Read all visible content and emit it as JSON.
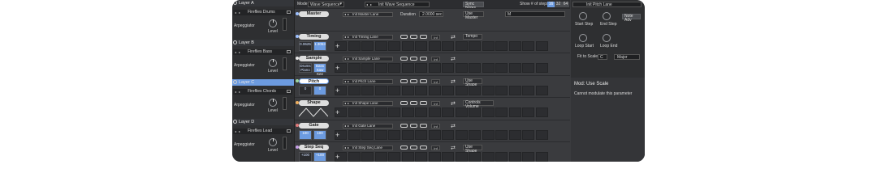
{
  "left": {
    "layers": [
      {
        "name": "Layer A",
        "preset": "Fireflies Drums",
        "arp": "Arpeggiator",
        "level": "Level",
        "selected": false
      },
      {
        "name": "Layer B",
        "preset": "Fireflies Bass",
        "arp": "Arpeggiator",
        "level": "Level",
        "selected": false
      },
      {
        "name": "Layer C",
        "preset": "Fireflies Chords",
        "arp": "Arpeggiator",
        "level": "Level",
        "selected": true
      },
      {
        "name": "Layer D",
        "preset": "Fireflies Lead",
        "arp": "Arpeggiator",
        "level": "Level",
        "selected": false
      }
    ]
  },
  "topbar": {
    "mode_label": "Mode",
    "mode_value": "Wave Sequence",
    "wave_seq_name": "Init Wave Sequence",
    "sync_notes": "Sync Notes",
    "steps_label": "Show # of steps",
    "steps": [
      "16",
      "32",
      "64"
    ]
  },
  "lanes": [
    {
      "name": "Master",
      "preset": "Init Master Lane",
      "duration_label": "Duration",
      "duration": "2.0000 sec",
      "use": "Use Master",
      "master_input": "M",
      "dot": "#9ec1ff"
    },
    {
      "name": "Timing",
      "preset": "Init Timing Lane",
      "use": "Tempo",
      "values": [
        "0.0625",
        "1.3053"
      ],
      "inf": "Inf",
      "dot": "#9ec1ff"
    },
    {
      "name": "Sample",
      "preset": "Init Sample Lane",
      "values": [
        "Drums Piano",
        "Bass Saw Key"
      ],
      "inf": "Inf",
      "dot": "#e8e8e8"
    },
    {
      "name": "Pitch",
      "preset": "Init Pitch Lane",
      "use": "Use Shape",
      "values": [
        "0",
        "0"
      ],
      "inf": "Inf",
      "dot": "#9ed7a0"
    },
    {
      "name": "Shape",
      "preset": "Init Shape Lane",
      "use": "Controls Volume",
      "inf": "Inf",
      "dot": "#f0b060"
    },
    {
      "name": "Gate",
      "preset": "Init Gate Lane",
      "values": [
        "100",
        "100"
      ],
      "inf": "Inf",
      "dot": "#e07a7a"
    },
    {
      "name": "Step Seq",
      "preset": "Init Step Seq Lane",
      "use": "Use Shape",
      "values": [
        "+100",
        "+100"
      ],
      "inf": "Inf",
      "dot": "#c8a0e8"
    }
  ],
  "right": {
    "lane_name": "Init Pitch Lane",
    "note_adv": "Note Adv",
    "start_step": "Start Step",
    "end_step": "End Step",
    "loop_start": "Loop Start",
    "loop_end": "Loop End",
    "fit_to_scale": "Fit to Scale",
    "scale_root": "C",
    "scale_type": "Major",
    "mod_title": "Mod: Use Scale",
    "mod_msg": "Cannot modulate this parameter"
  }
}
